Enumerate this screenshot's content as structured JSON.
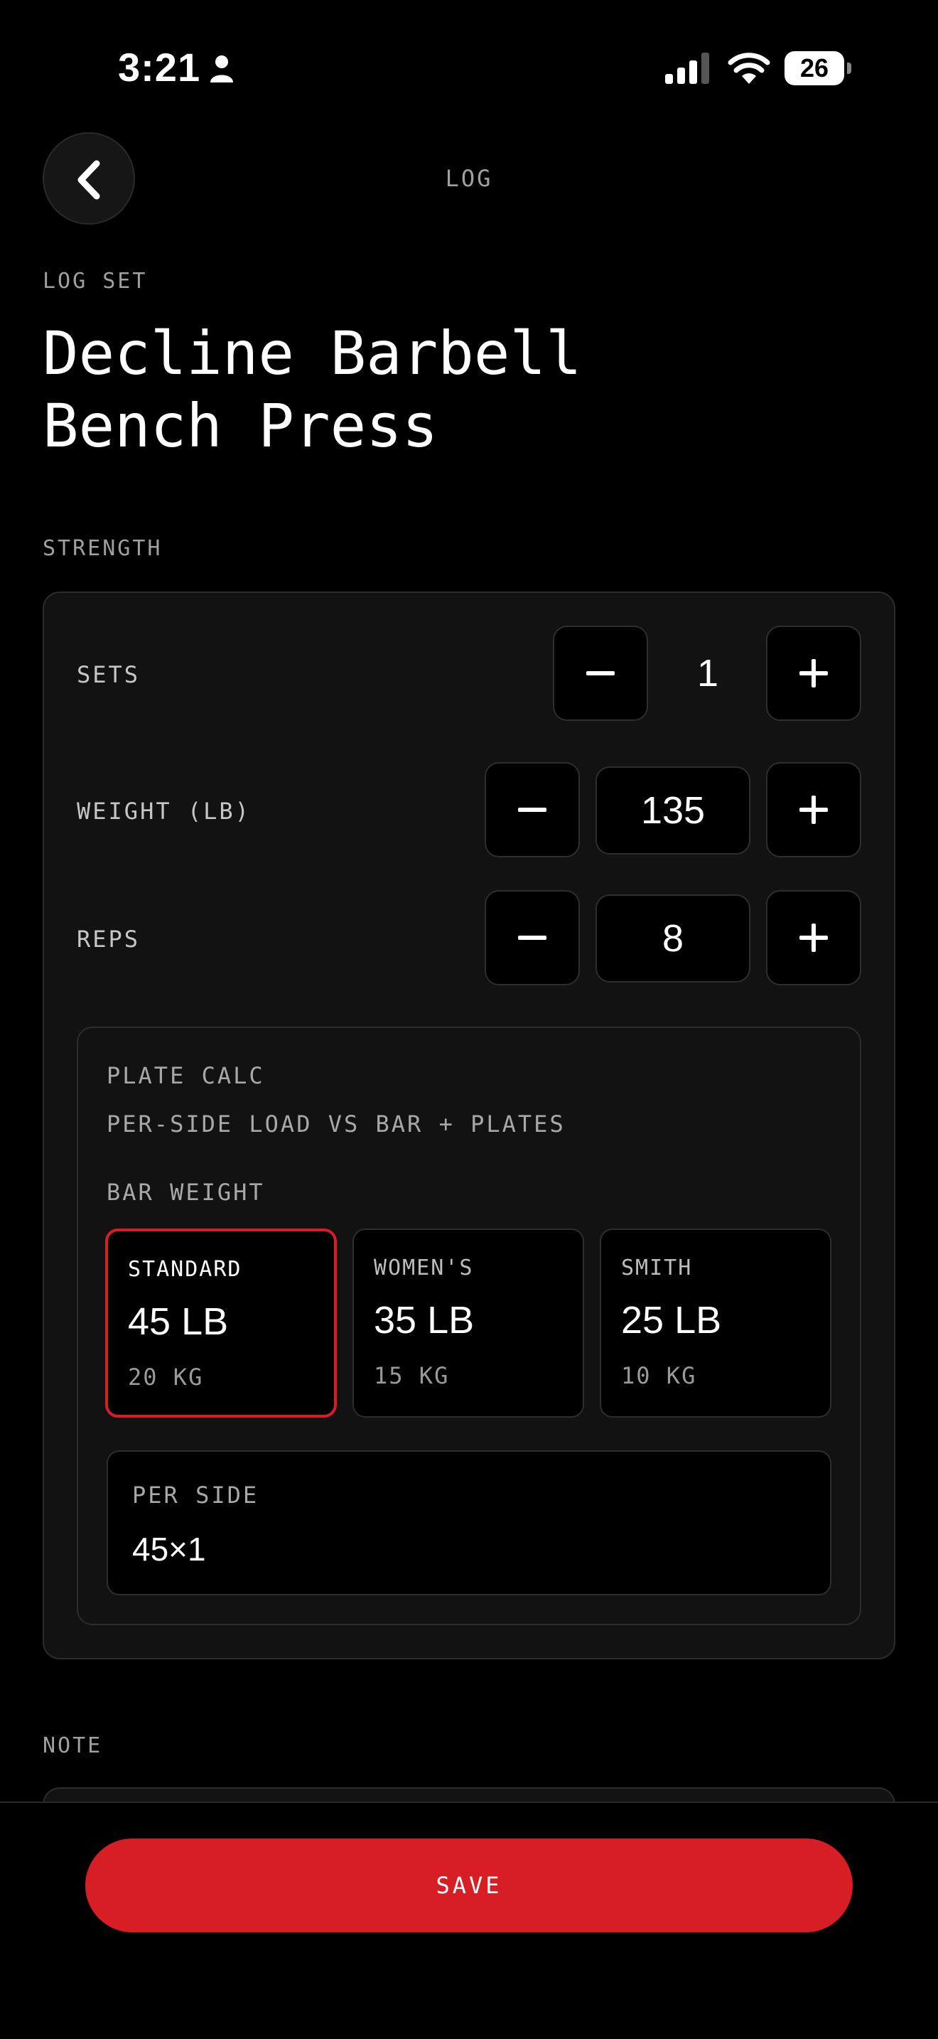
{
  "status_bar": {
    "time": "3:21",
    "battery": "26"
  },
  "header": {
    "title": "LOG"
  },
  "kicker": "LOG SET",
  "exercise": {
    "line1": "Decline Barbell",
    "line2": "Bench Press"
  },
  "section_strength": "STRENGTH",
  "rows": {
    "sets": {
      "label": "SETS",
      "value": "1"
    },
    "weight": {
      "label": "WEIGHT (LB)",
      "value": "135"
    },
    "reps": {
      "label": "REPS",
      "value": "8"
    }
  },
  "plate_calc": {
    "title": "PLATE CALC",
    "subtitle": "PER-SIDE LOAD VS BAR + PLATES",
    "bar_weight_label": "BAR WEIGHT",
    "options": [
      {
        "name": "STANDARD",
        "lb": "45 LB",
        "kg": "20 KG",
        "selected": true
      },
      {
        "name": "WOMEN'S",
        "lb": "35 LB",
        "kg": "15 KG",
        "selected": false
      },
      {
        "name": "SMITH",
        "lb": "25 LB",
        "kg": "10 KG",
        "selected": false
      }
    ],
    "per_side_label": "PER SIDE",
    "per_side_value": "45×1"
  },
  "section_note": "NOTE",
  "save_label": "SAVE",
  "colors": {
    "accent": "#d81e25",
    "background": "#000000",
    "card": "#121212"
  },
  "icons": [
    "person-icon",
    "signal-icon",
    "wifi-icon",
    "battery-icon",
    "chevron-left-icon",
    "minus-icon",
    "plus-icon"
  ]
}
